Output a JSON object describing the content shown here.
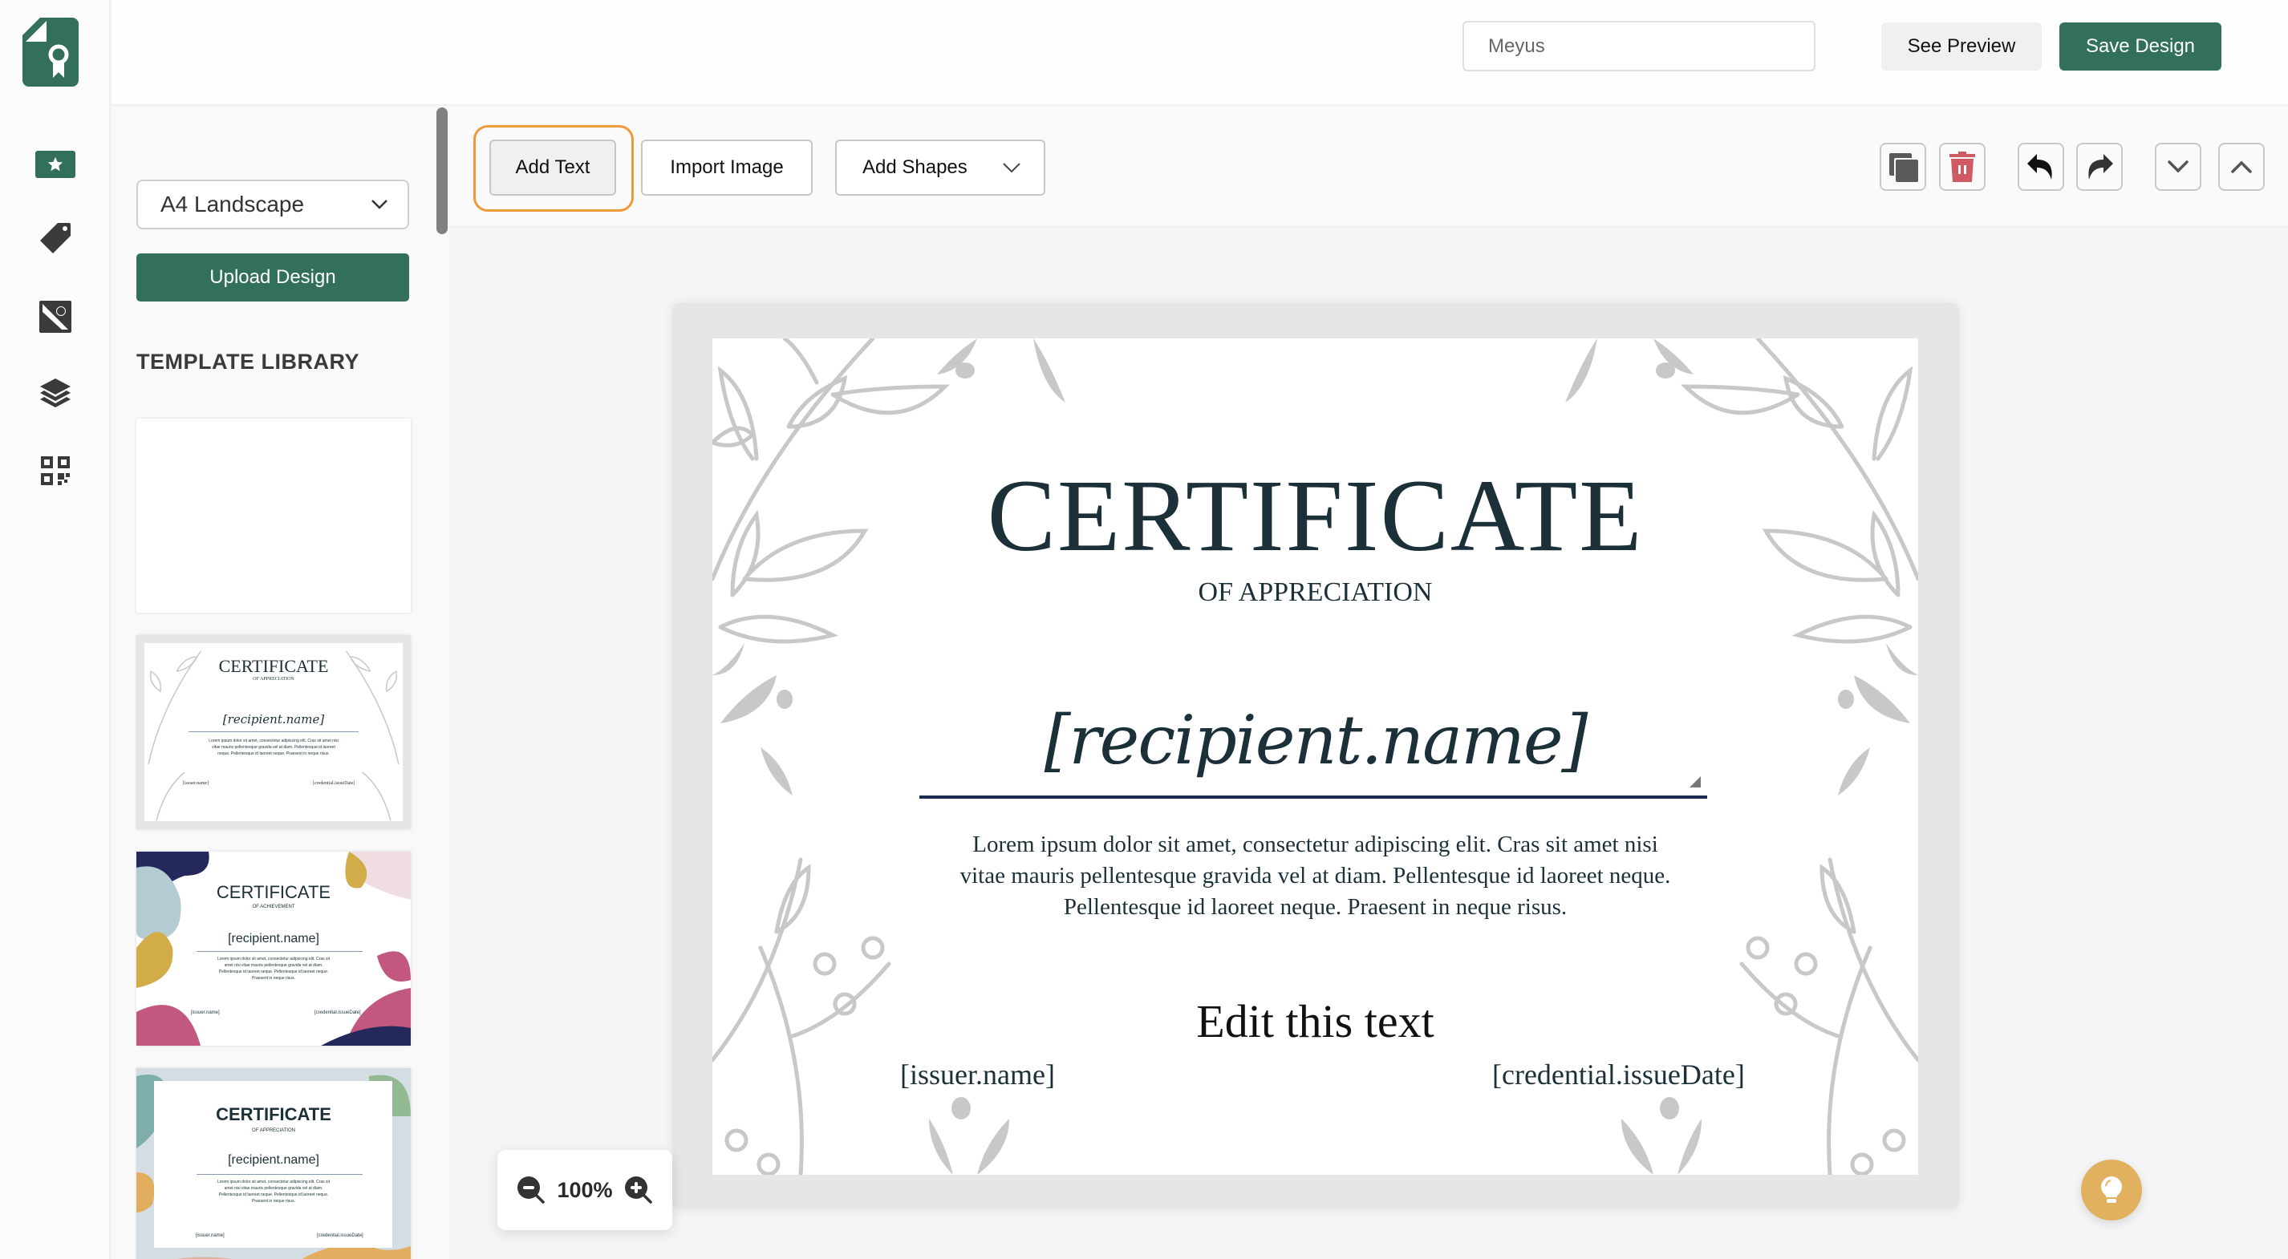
{
  "app": {
    "logo": "certificate-ribbon-logo"
  },
  "rail": {
    "items": [
      {
        "icon": "star-icon",
        "name": "templates",
        "active": true
      },
      {
        "icon": "tag-icon",
        "name": "attributes",
        "active": false
      },
      {
        "icon": "image-icon",
        "name": "images",
        "active": false
      },
      {
        "icon": "layers-icon",
        "name": "layers",
        "active": false
      },
      {
        "icon": "qr-code-icon",
        "name": "qr-code",
        "active": false
      }
    ]
  },
  "header": {
    "design_name_value": "Meyus",
    "see_preview_label": "See Preview",
    "save_design_label": "Save Design"
  },
  "panel": {
    "page_size_selected": "A4 Landscape",
    "upload_label": "Upload Design",
    "library_title": "TEMPLATE LIBRARY",
    "templates": [
      {
        "name": "blank"
      },
      {
        "name": "floral-appreciation",
        "title": "CERTIFICATE",
        "subtitle": "OF APPRECIATION",
        "recipient": "[recipient.name]",
        "issuer": "[issuer.name]",
        "date": "[credential.issueDate]"
      },
      {
        "name": "abstract-achievement",
        "title": "CERTIFICATE",
        "subtitle": "OF ACHIEVEMENT",
        "recipient": "[recipient.name]",
        "issuer": "[issuer.name]",
        "date": "[credential.issueDate]"
      },
      {
        "name": "pastel-appreciation",
        "title": "CERTIFICATE",
        "subtitle": "OF APPRECIATION",
        "recipient": "[recipient.name]",
        "issuer": "[issuer.name]",
        "date": "[credential.issueDate]"
      }
    ]
  },
  "toolbar": {
    "add_text_label": "Add Text",
    "import_image_label": "Import Image",
    "add_shapes_label": "Add Shapes",
    "icons": [
      "duplicate-icon",
      "delete-icon",
      "undo-icon",
      "redo-icon",
      "move-down-icon",
      "move-up-icon"
    ]
  },
  "canvas": {
    "title": "CERTIFICATE",
    "subtitle": "OF APPRECIATION",
    "recipient": "[recipient.name]",
    "body": "Lorem ipsum dolor sit amet, consectetur adipiscing elit. Cras sit amet nisi vitae mauris pellentesque gravida vel at diam. Pellentesque id laoreet neque. Pellentesque id laoreet neque. Praesent in neque risus.",
    "edit_text": "Edit this text",
    "issuer": "[issuer.name]",
    "issue_date": "[credential.issueDate]"
  },
  "zoom": {
    "level": "100%"
  },
  "colors": {
    "brand": "#32705c",
    "highlight": "#f0993a",
    "danger": "#d05a64",
    "tip": "#e2b160",
    "text_dark": "#1b3038",
    "floral": "#c8c8c8"
  }
}
